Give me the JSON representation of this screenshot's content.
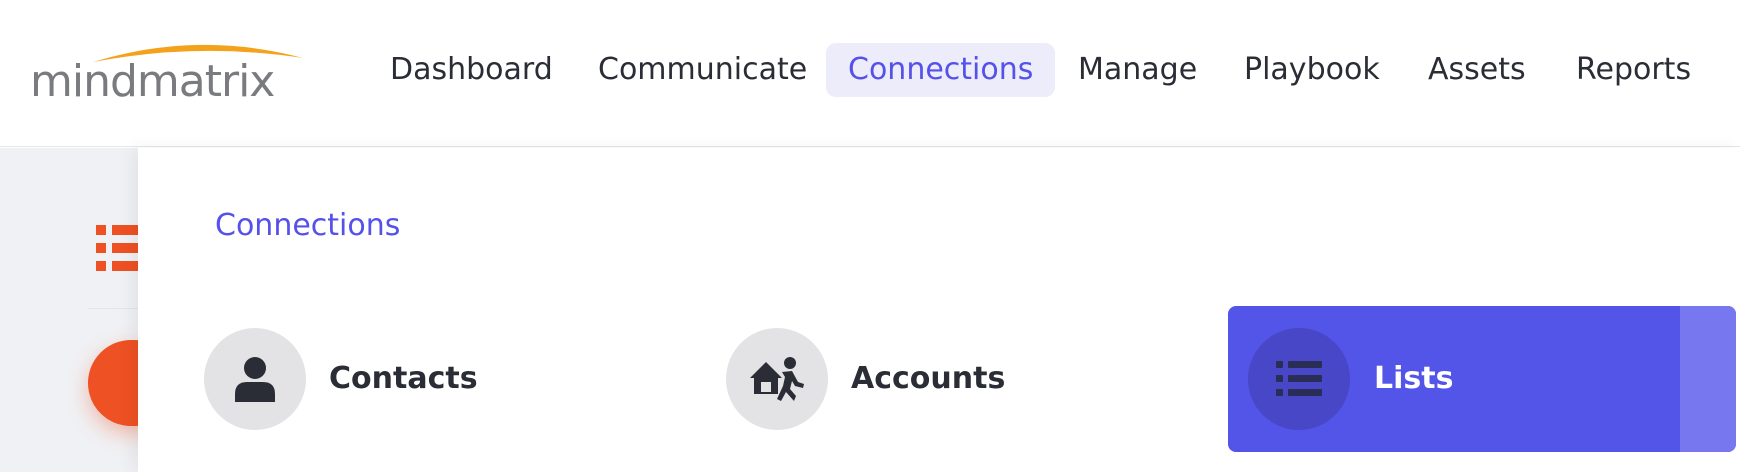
{
  "logo": {
    "text": "mindmatrix"
  },
  "nav": {
    "items": [
      {
        "label": "Dashboard"
      },
      {
        "label": "Communicate"
      },
      {
        "label": "Connections"
      },
      {
        "label": "Manage"
      },
      {
        "label": "Playbook"
      },
      {
        "label": "Assets"
      },
      {
        "label": "Reports"
      }
    ],
    "active_index": 2
  },
  "dropdown": {
    "title": "Connections",
    "items": [
      {
        "label": "Contacts",
        "icon": "user-icon"
      },
      {
        "label": "Accounts",
        "icon": "house-runner-icon"
      },
      {
        "label": "Lists",
        "icon": "list-icon",
        "selected": true
      }
    ]
  },
  "colors": {
    "accent": "#5551e9",
    "accent_bg": "#ececfb",
    "selected_card": "#5354e8",
    "orange": "#ee5123",
    "text": "#2a2d35"
  }
}
